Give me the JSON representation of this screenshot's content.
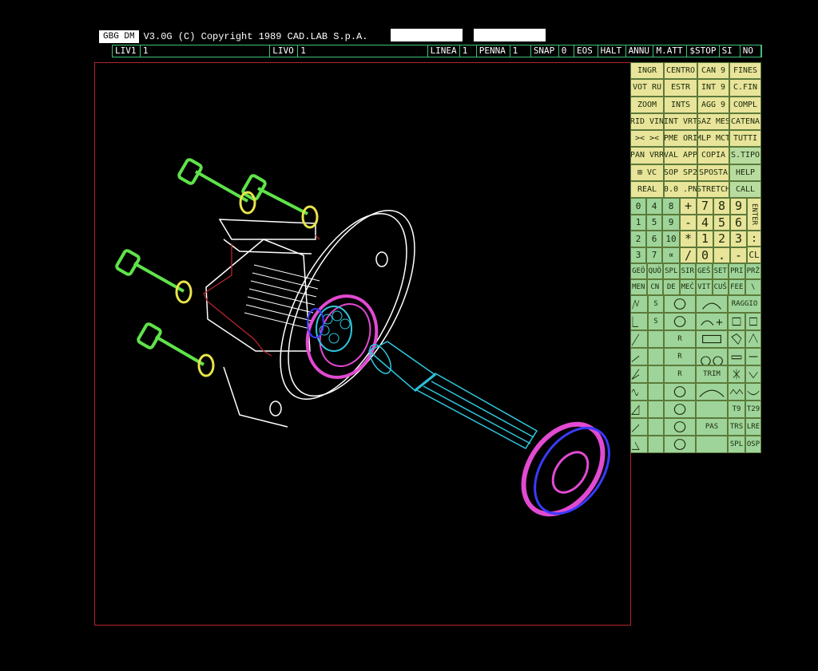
{
  "title": {
    "tag": "GBG DM",
    "text": "V3.0G (C) Copyright 1989 CAD.LAB S.p.A."
  },
  "status": [
    {
      "label": "LIV1",
      "w": 32
    },
    {
      "label": "1",
      "w": 178
    },
    {
      "label": "LIVO",
      "w": 32
    },
    {
      "label": "1",
      "w": 178
    },
    {
      "label": "LINEA",
      "w": 38
    },
    {
      "label": "1",
      "w": 16
    },
    {
      "label": "PENNA",
      "w": 40
    },
    {
      "label": "1",
      "w": 22
    },
    {
      "label": "SNAP",
      "w": 32
    },
    {
      "label": "0",
      "w": 14
    },
    {
      "label": "EOS",
      "w": 26
    },
    {
      "label": "HALT",
      "w": 32
    },
    {
      "label": "ANNU",
      "w": 32
    },
    {
      "label": "M.ATT",
      "w": 40
    },
    {
      "label": "$STOP",
      "w": 38
    },
    {
      "label": "SI",
      "w": 22
    },
    {
      "label": "NO",
      "w": 22
    }
  ],
  "menu_top": [
    [
      "INGR",
      "CENTRO",
      "CAN  9",
      "FINES"
    ],
    [
      "VOT RU",
      "ESTR",
      "INT  9",
      "C.FIN"
    ],
    [
      "ZOOM",
      "INTS",
      "AGG  9",
      "COMPL"
    ],
    [
      "RID VIN",
      "INT VRT",
      "SAZ MES",
      "CATENA"
    ],
    [
      "><  ><",
      "PME ORI",
      "MLP MCT",
      "TUTTI"
    ],
    [
      "PAN VRR",
      "VAL APP",
      "COPIA",
      "S.TIPO"
    ],
    [
      "⊞ VC",
      "SOP SP2",
      "SPOSTA",
      "HELP"
    ],
    [
      "REAL",
      "0.0 .PN",
      "STRETCH",
      "CALL"
    ]
  ],
  "num_left": [
    [
      "0",
      "4",
      "8"
    ],
    [
      "1",
      "5",
      "9"
    ],
    [
      "2",
      "6",
      "10"
    ],
    [
      "3",
      "7",
      "∝"
    ]
  ],
  "num_right": [
    [
      "+",
      "7",
      "8",
      "9"
    ],
    [
      "-",
      "4",
      "5",
      "6"
    ],
    [
      "*",
      "1",
      "2",
      "3"
    ],
    [
      "/",
      "0",
      ".",
      "-"
    ]
  ],
  "enter_label": "ENTER",
  "colon_label": ":",
  "cl_label": "CL",
  "menu_mid": [
    [
      "GEÖ",
      "QUÖ",
      "SPL",
      "SIR",
      "GEŠ",
      "SET",
      "PRI",
      "PRŽ"
    ],
    [
      "MEN",
      "CN",
      "DE",
      "MEČ",
      "VIT",
      "CUŠ",
      "FEE",
      "\\"
    ]
  ],
  "menu_icons": {
    "s1": "S",
    "s2": "S",
    "r1": "R",
    "r2": "R",
    "r3": "R",
    "raggio": "RAGGIO",
    "trim": "TRIM",
    "pas": "PAS",
    "t9": "T9",
    "t29": "T29",
    "trs": "TRS",
    "lre": "LRE",
    "spl": "SPL",
    "osp": "OSP"
  }
}
